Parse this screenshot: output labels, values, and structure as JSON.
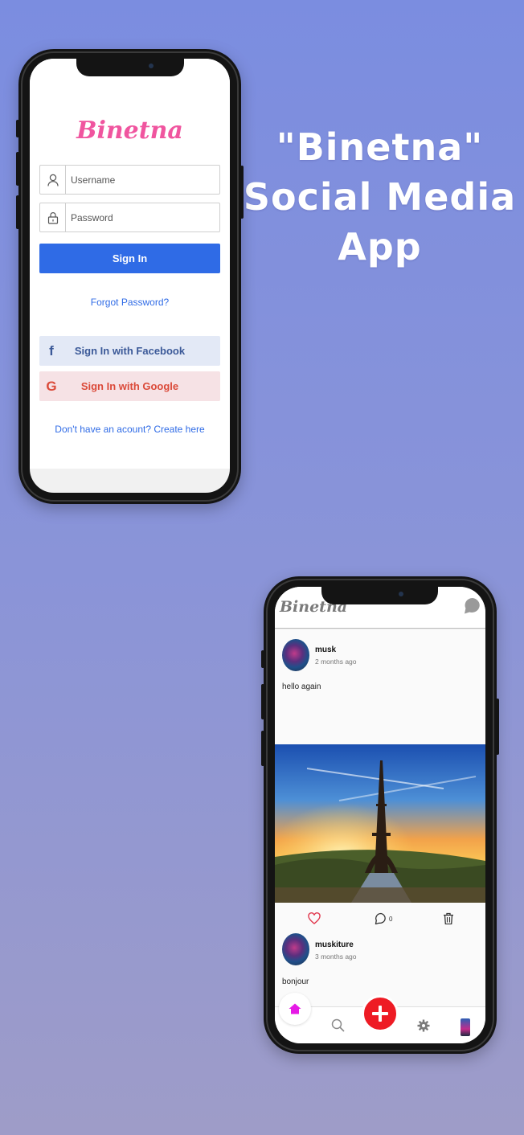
{
  "promo": {
    "line1": "\"Binetna\"",
    "line2": "Social Media",
    "line3": "App"
  },
  "login": {
    "logo": "Binetna",
    "username_placeholder": "Username",
    "password_placeholder": "Password",
    "sign_in_label": "Sign In",
    "forgot_password": "Forgot Password?",
    "facebook_label": "Sign In with Facebook",
    "google_label": "Sign In with Google",
    "facebook_icon": "f",
    "google_icon": "G",
    "register_link": "Don't have an acount? Create here"
  },
  "feed": {
    "logo": "Binetna",
    "posts": [
      {
        "user": "musk",
        "time": "2 months ago",
        "text": "hello again",
        "comments": "0"
      },
      {
        "user": "muskiture",
        "time": "3 months ago",
        "text": "bonjour"
      }
    ]
  },
  "colors": {
    "primary": "#2f6be6",
    "brand_pink": "#f0559f",
    "facebook": "#3b5998",
    "google": "#db4a39",
    "add_fab": "#ee1b24",
    "home_active": "#e619e6"
  },
  "icons": {
    "user": "user-icon",
    "lock": "lock-icon",
    "chat": "chat-icon",
    "like": "heart-icon",
    "comment": "comment-icon",
    "delete": "trash-icon",
    "home": "home-icon",
    "search": "search-icon",
    "add": "plus-icon",
    "settings": "gear-icon",
    "profile": "profile-icon"
  }
}
